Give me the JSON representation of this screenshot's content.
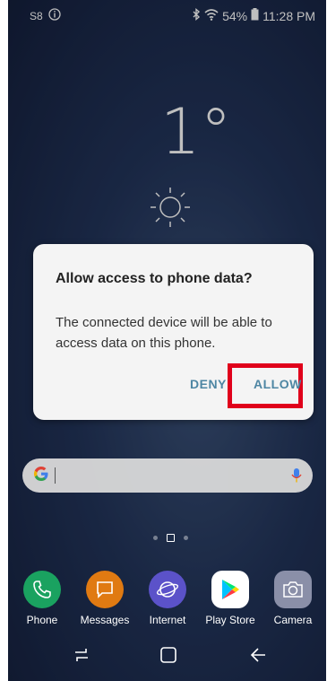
{
  "status_bar": {
    "left_text": "S8",
    "battery": "54%",
    "time": "11:28 PM"
  },
  "weather": {
    "temperature": "1°"
  },
  "dialog": {
    "title": "Allow access to phone data?",
    "message": "The connected device will be able to access data on this phone.",
    "deny_label": "DENY",
    "allow_label": "ALLOW",
    "highlight_color": "#e0001b"
  },
  "search_bar": {
    "logo": "G"
  },
  "dock": [
    {
      "label": "Phone",
      "icon": "phone-icon",
      "color": "#1aa260"
    },
    {
      "label": "Messages",
      "icon": "messages-icon",
      "color": "#e07a12"
    },
    {
      "label": "Internet",
      "icon": "internet-icon",
      "color": "#5b52c9"
    },
    {
      "label": "Play Store",
      "icon": "play-store-icon",
      "color": "#ffffff"
    },
    {
      "label": "Camera",
      "icon": "camera-icon",
      "color": "#8a8fa8"
    }
  ]
}
